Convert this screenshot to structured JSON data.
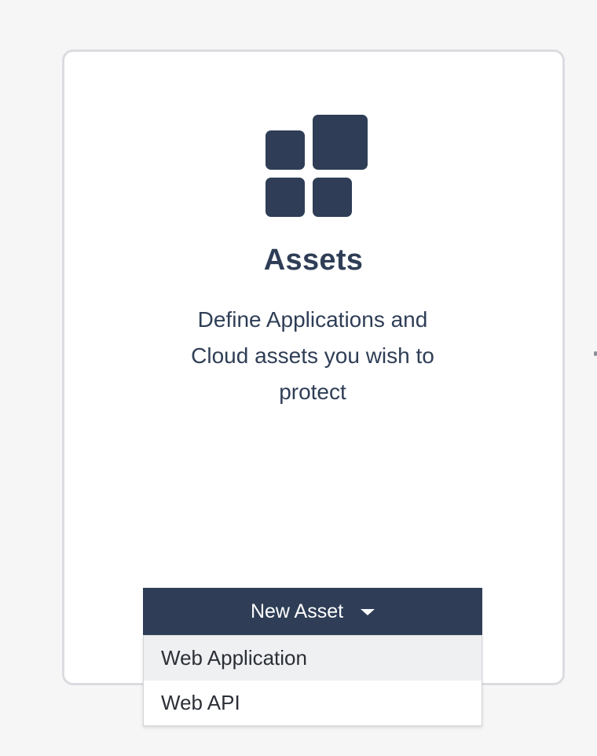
{
  "card": {
    "icon": "grid-tiles-icon",
    "title": "Assets",
    "description": "Define Applications and Cloud assets you wish to protect"
  },
  "new_asset_button": {
    "label": "New Asset",
    "icon": "caret-down-icon"
  },
  "dropdown": {
    "items": [
      {
        "label": "Web Application",
        "highlighted": true
      },
      {
        "label": "Web API",
        "highlighted": false
      }
    ]
  },
  "colors": {
    "primary": "#2f3e56",
    "background": "#f6f6f6",
    "card_border": "#dadce0",
    "highlight": "#eff0f2"
  }
}
